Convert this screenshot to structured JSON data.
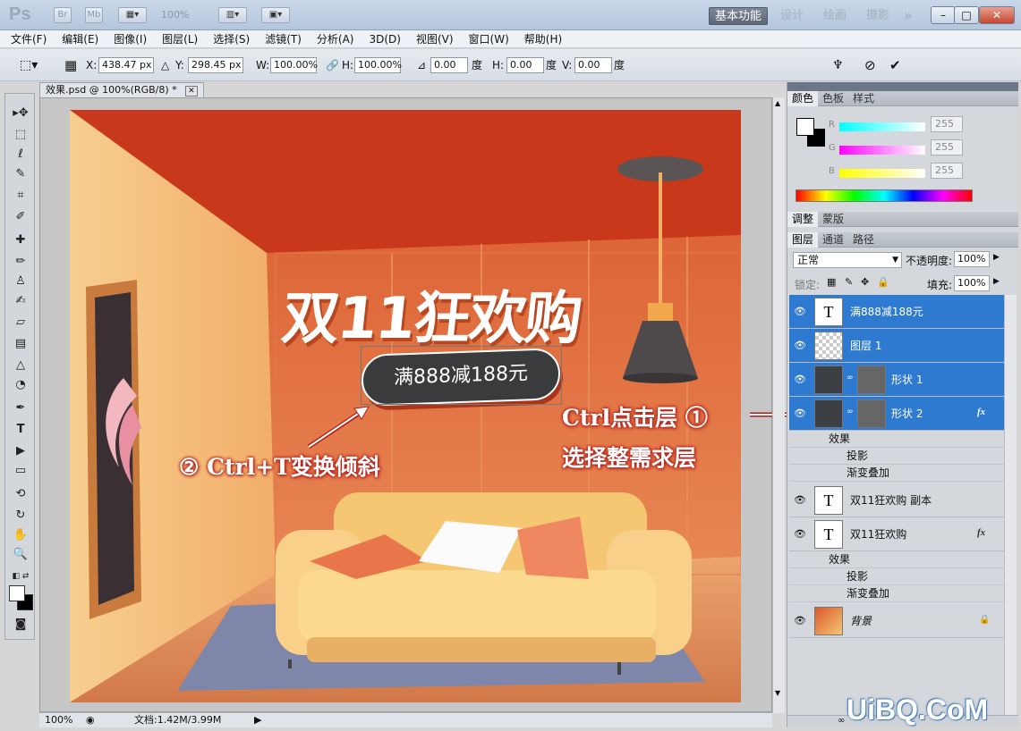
{
  "app": {
    "logo": "Ps",
    "bridge": "Br",
    "minibridge": "Mb",
    "zoom": "100%",
    "workspaces": [
      "基本功能",
      "设计",
      "绘画",
      "摄影"
    ],
    "more": "»"
  },
  "menu": [
    "文件(F)",
    "编辑(E)",
    "图像(I)",
    "图层(L)",
    "选择(S)",
    "滤镜(T)",
    "分析(A)",
    "3D(D)",
    "视图(V)",
    "窗口(W)",
    "帮助(H)"
  ],
  "options": {
    "x_label": "X:",
    "x_value": "438.47 px",
    "y_label": "Y:",
    "y_value": "298.45 px",
    "w_label": "W:",
    "w_value": "100.00%",
    "h_label": "H:",
    "h_value": "100.00%",
    "angle_value": "0.00",
    "angle_unit": "度",
    "hskew_label": "H:",
    "hskew_value": "0.00",
    "hskew_unit": "度",
    "vskew_label": "V:",
    "vskew_value": "0.00",
    "vskew_unit": "度"
  },
  "document": {
    "tab_title": "效果.psd @ 100%(RGB/8) *",
    "title_text": "双11狂欢购",
    "badge_text": "满888减188元",
    "status_zoom": "100%",
    "status_doc": "文档:1.42M/3.99M"
  },
  "annotations": {
    "step1_line1": "Ctrl点击层 ①",
    "step1_line2": "选择整需求层",
    "step2": "② Ctrl+T变换倾斜"
  },
  "panels": {
    "color_tabs": [
      "颜色",
      "色板",
      "样式"
    ],
    "r_label": "R",
    "g_label": "G",
    "b_label": "B",
    "r_value": "255",
    "g_value": "255",
    "b_value": "255",
    "adjust_tabs": [
      "调整",
      "蒙版"
    ],
    "layer_tabs": [
      "图层",
      "通道",
      "路径"
    ],
    "blend_mode": "正常",
    "opacity_label": "不透明度:",
    "opacity_value": "100%",
    "lock_label": "锁定:",
    "fill_label": "填充:",
    "fill_value": "100%"
  },
  "layers": [
    {
      "name": "满888减188元",
      "type": "text",
      "selected": true
    },
    {
      "name": "图层 1",
      "type": "pixel",
      "selected": true
    },
    {
      "name": "形状 1",
      "type": "shape",
      "selected": true
    },
    {
      "name": "形状 2",
      "type": "shape",
      "selected": true,
      "fx": "fx"
    },
    {
      "name": "双11狂欢购 副本",
      "type": "text",
      "selected": false
    },
    {
      "name": "双11狂欢购",
      "type": "text",
      "selected": false,
      "fx": "fx"
    },
    {
      "name": "背景",
      "type": "background",
      "selected": false
    }
  ],
  "effects": {
    "label": "效果",
    "shadow": "投影",
    "gradient": "渐变叠加"
  },
  "watermark": "UiBQ.CoM",
  "colors": {
    "selection": "#2e7ad1",
    "canvas_wall": "#e17746",
    "annotation_glow": "#b3201a"
  }
}
